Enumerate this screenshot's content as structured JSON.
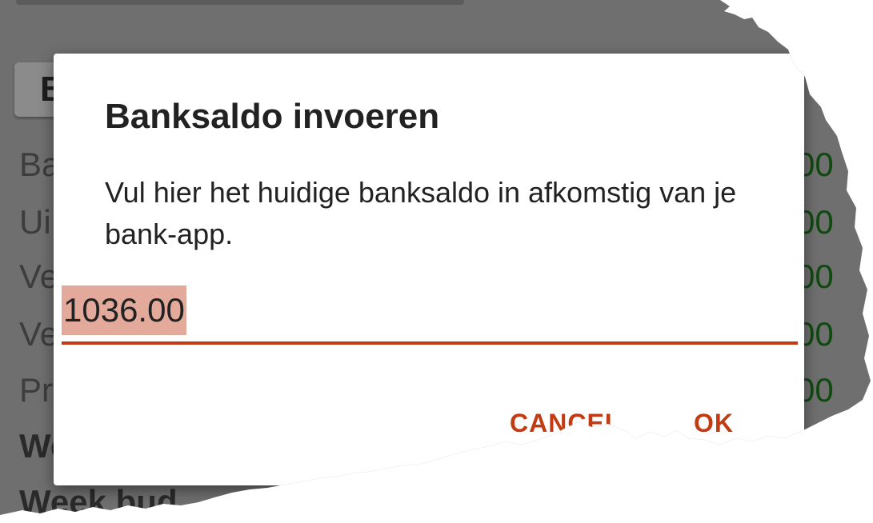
{
  "background": {
    "button_label": "B",
    "rows": [
      {
        "label": "Ba",
        "value": "00",
        "bold": false
      },
      {
        "label": "Ui",
        "value": "00",
        "bold": false
      },
      {
        "label": "Ve",
        "value": "00",
        "bold": false
      },
      {
        "label": "Ve",
        "value": "00",
        "bold": false
      },
      {
        "label": "Pr",
        "value": "00",
        "bold": false
      },
      {
        "label": "We",
        "value": "",
        "bold": true
      },
      {
        "label": "Week bud",
        "value": "",
        "bold": true
      }
    ]
  },
  "dialog": {
    "title": "Banksaldo invoeren",
    "message": "Vul hier het huidige banksaldo in afkomstig van je bank-app.",
    "amount_value": "1036.00",
    "cancel_label": "CANCEL",
    "ok_label": "OK"
  },
  "colors": {
    "accent": "#c23b12",
    "selection": "#e3aa9c",
    "scrim": "#6f6f6f",
    "value_green": "#0f4a0f"
  }
}
